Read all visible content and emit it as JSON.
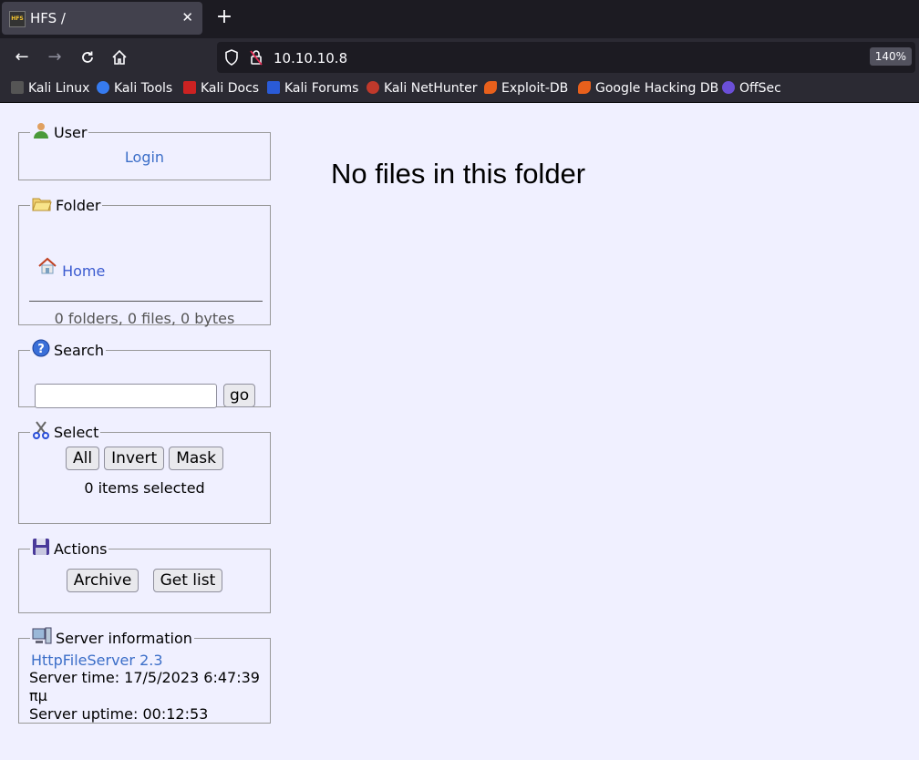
{
  "browser": {
    "tab_title": "HFS /",
    "favicon_text": "HFS",
    "url": "10.10.10.8",
    "zoom": "140%",
    "bookmarks": [
      {
        "label": "Kali Linux",
        "color": "#111111"
      },
      {
        "label": "Kali Tools",
        "color": "#367bf0"
      },
      {
        "label": "Kali Docs",
        "color": "#cc2222"
      },
      {
        "label": "Kali Forums",
        "color": "#2a5bd7"
      },
      {
        "label": "Kali NetHunter",
        "color": "#c0392b"
      },
      {
        "label": "Exploit-DB",
        "color": "#e8601c"
      },
      {
        "label": "Google Hacking DB",
        "color": "#e8601c"
      },
      {
        "label": "OffSec",
        "color": "#6b4fd8"
      }
    ]
  },
  "user": {
    "legend": "User",
    "login_link": "Login"
  },
  "folder": {
    "legend": "Folder",
    "home_link": "Home",
    "stats": "0 folders, 0 files, 0 bytes"
  },
  "search": {
    "legend": "Search",
    "input_value": "",
    "go_button": "go"
  },
  "select": {
    "legend": "Select",
    "all_button": "All",
    "invert_button": "Invert",
    "mask_button": "Mask",
    "status": "0 items selected"
  },
  "actions": {
    "legend": "Actions",
    "archive_button": "Archive",
    "getlist_button": "Get list"
  },
  "server": {
    "legend": "Server information",
    "version_link": "HttpFileServer 2.3",
    "time": "Server time: 17/5/2023 6:47:39 πμ",
    "uptime": "Server uptime: 00:12:53"
  },
  "main": {
    "message": "No files in this folder"
  }
}
